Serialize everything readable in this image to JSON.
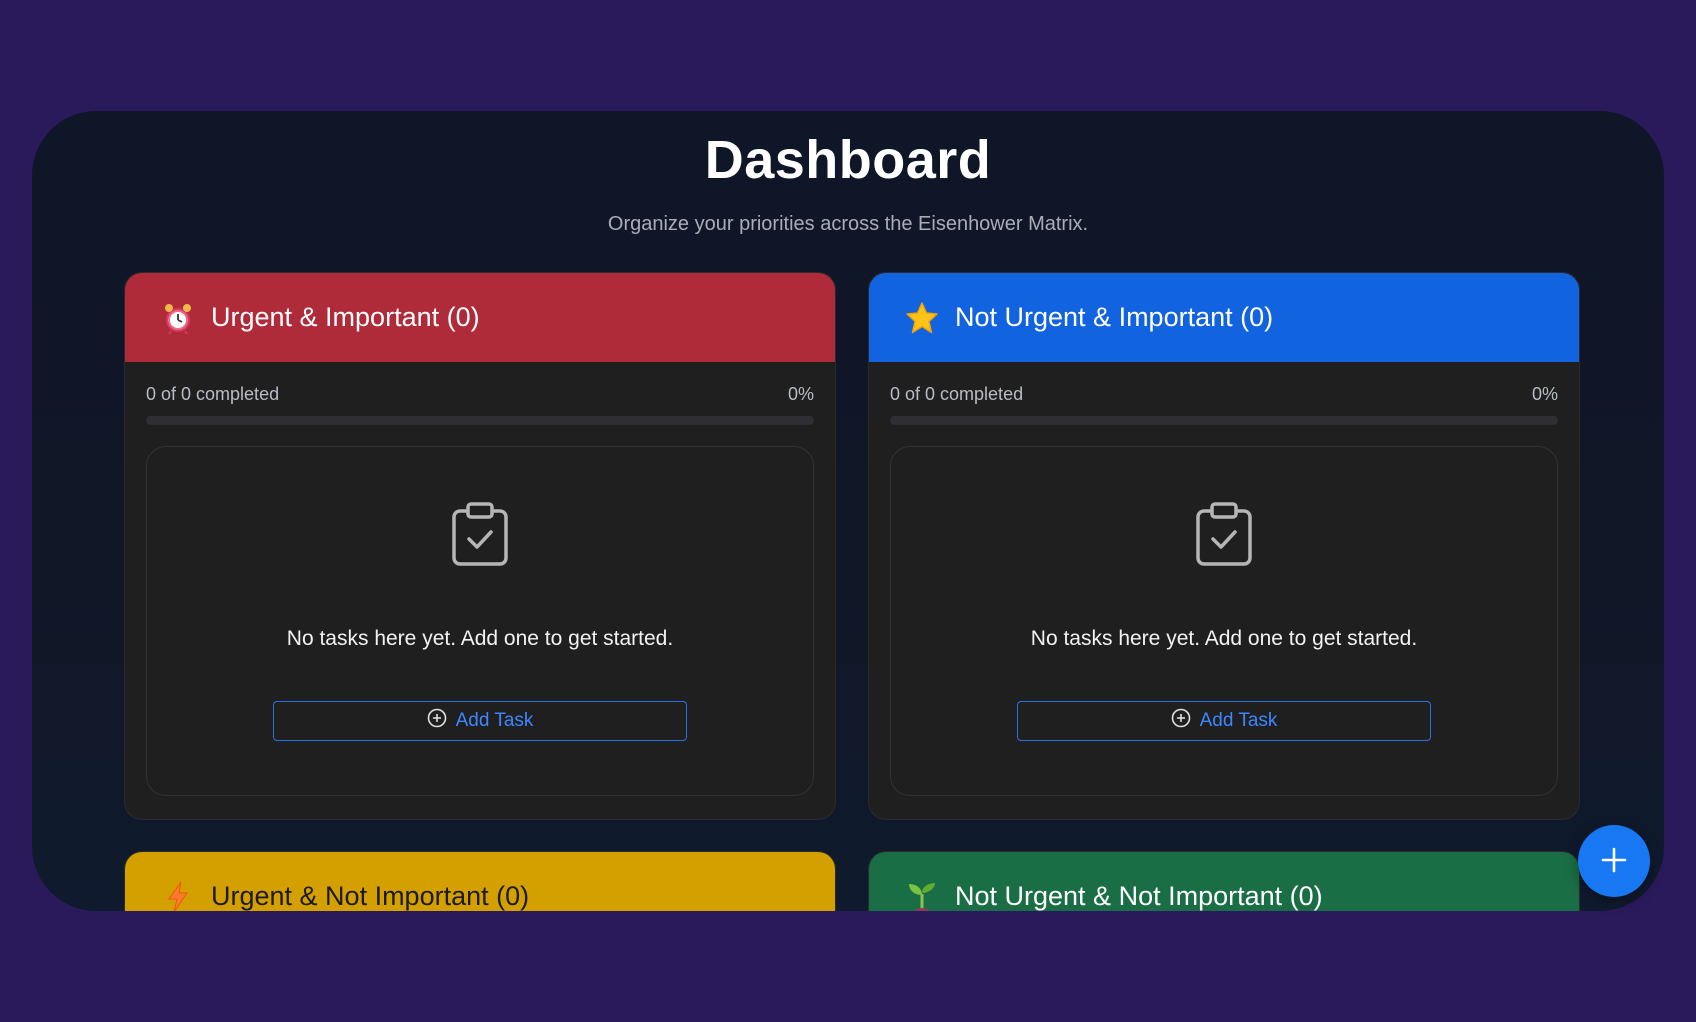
{
  "header": {
    "title": "Dashboard",
    "subtitle": "Organize your priorities across the Eisenhower Matrix."
  },
  "colors": {
    "background": "#2a1a5c",
    "urgent_important": "#b02b3a",
    "not_urgent_important": "#1263e0",
    "urgent_not_important": "#d4a000",
    "not_urgent_not_important": "#1a6e45",
    "accent": "#1877f2"
  },
  "quadrants": [
    {
      "title": "Urgent & Important (0)",
      "icon": "alarm-clock-icon",
      "progress_text": "0 of 0 completed",
      "progress_percent_label": "0%",
      "progress_percent": 0,
      "empty_message": "No tasks here yet. Add one to get started.",
      "add_label": "Add Task"
    },
    {
      "title": "Not Urgent & Important (0)",
      "icon": "star-icon",
      "progress_text": "0 of 0 completed",
      "progress_percent_label": "0%",
      "progress_percent": 0,
      "empty_message": "No tasks here yet. Add one to get started.",
      "add_label": "Add Task"
    },
    {
      "title": "Urgent & Not Important (0)",
      "icon": "lightning-icon"
    },
    {
      "title": "Not Urgent & Not Important (0)",
      "icon": "seedling-icon"
    }
  ],
  "fab": {
    "icon": "plus-icon"
  }
}
